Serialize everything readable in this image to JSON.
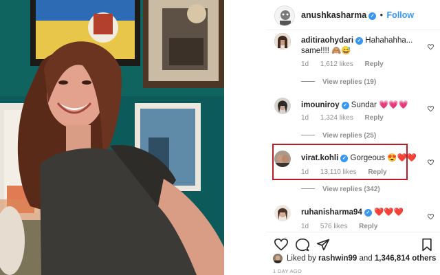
{
  "post": {
    "author": "anushkasharma",
    "follow_label": "Follow",
    "separator": "•",
    "verified_mark": "✓"
  },
  "comments": [
    {
      "username": "aditiraohydari",
      "verified": true,
      "text": "Hahahahha... same!!!! 🙈😅",
      "age": "1d",
      "likes": "1,612 likes",
      "reply_label": "Reply",
      "view_replies": "View replies (19)",
      "avatar_color": "#6b4a3a"
    },
    {
      "username": "imouniroy",
      "verified": true,
      "text": "Sundar 💗💗💗",
      "age": "1d",
      "likes": "1,324 likes",
      "reply_label": "Reply",
      "view_replies": "View replies (25)",
      "avatar_color": "#2d2a28"
    },
    {
      "username": "virat.kohli",
      "verified": true,
      "text": "Gorgeous 😍❤️❤️",
      "age": "1d",
      "likes": "13,110 likes",
      "reply_label": "Reply",
      "view_replies": "View replies (342)",
      "avatar_color": "#5a4436",
      "highlighted": true
    },
    {
      "username": "ruhanisharma94",
      "verified": true,
      "text": "❤️❤️❤️",
      "age": "1d",
      "likes": "576 likes",
      "reply_label": "Reply",
      "avatar_color": "#c9b8a8"
    }
  ],
  "actions": {
    "icons": [
      "heart-icon",
      "comment-icon",
      "share-icon",
      "bookmark-icon"
    ]
  },
  "likes_summary": {
    "prefix": "Liked by",
    "user": "rashwin99",
    "conjunction": "and",
    "others": "1,346,814 others"
  },
  "timestamp": "1 DAY AGO",
  "colors": {
    "accent": "#3897f0",
    "highlight_border": "#b81c26",
    "muted": "#8e8e8e",
    "text": "#262626",
    "heart_red": "#e0245e",
    "heart_pink": "#ff4fa3"
  }
}
